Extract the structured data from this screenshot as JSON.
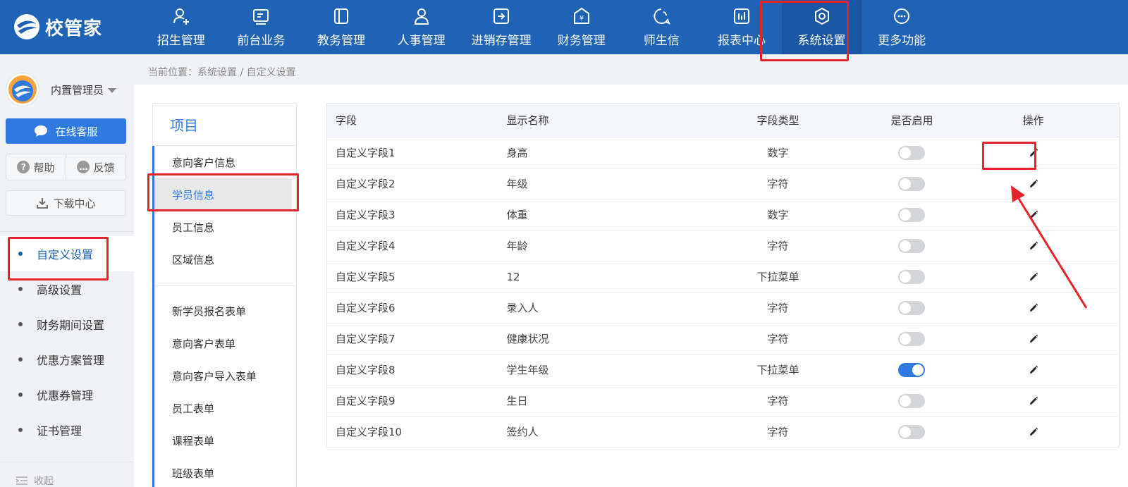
{
  "brand": {
    "name": "校管家"
  },
  "nav": [
    {
      "label": "招生管理",
      "icon": "user-plus-icon"
    },
    {
      "label": "前台业务",
      "icon": "monitor-icon"
    },
    {
      "label": "教务管理",
      "icon": "book-icon"
    },
    {
      "label": "人事管理",
      "icon": "person-icon"
    },
    {
      "label": "进销存管理",
      "icon": "arrow-box-icon"
    },
    {
      "label": "财务管理",
      "icon": "yen-icon"
    },
    {
      "label": "师生信",
      "icon": "chat-icon"
    },
    {
      "label": "报表中心",
      "icon": "bar-chart-icon"
    },
    {
      "label": "系统设置",
      "icon": "gear-icon",
      "active": true
    },
    {
      "label": "更多功能",
      "icon": "more-icon"
    }
  ],
  "user": {
    "name": "内置管理员"
  },
  "sidebar": {
    "service_label": "在线客服",
    "help_label": "帮助",
    "feedback_label": "反馈",
    "download_label": "下载中心",
    "menu": [
      {
        "label": "自定义设置",
        "active": true
      },
      {
        "label": "高级设置"
      },
      {
        "label": "财务期间设置"
      },
      {
        "label": "优惠方案管理"
      },
      {
        "label": "优惠券管理"
      },
      {
        "label": "证书管理"
      }
    ],
    "collapse_label": "收起"
  },
  "breadcrumb": "当前位置：系统设置 / 自定义设置",
  "categories": {
    "title": "项目",
    "group1": [
      "意向客户信息",
      "学员信息",
      "员工信息",
      "区域信息"
    ],
    "group2": [
      "新学员报名表单",
      "意向客户表单",
      "意向客户导入表单",
      "员工表单",
      "课程表单",
      "班级表单"
    ],
    "active": "学员信息"
  },
  "table": {
    "headers": {
      "field": "字段",
      "display": "显示名称",
      "type": "字段类型",
      "enabled": "是否启用",
      "action": "操作"
    },
    "rows": [
      {
        "field": "自定义字段1",
        "display": "身高",
        "type": "数字",
        "enabled": false
      },
      {
        "field": "自定义字段2",
        "display": "年级",
        "type": "字符",
        "enabled": false
      },
      {
        "field": "自定义字段3",
        "display": "体重",
        "type": "数字",
        "enabled": false
      },
      {
        "field": "自定义字段4",
        "display": "年龄",
        "type": "字符",
        "enabled": false
      },
      {
        "field": "自定义字段5",
        "display": "12",
        "type": "下拉菜单",
        "enabled": false
      },
      {
        "field": "自定义字段6",
        "display": "录入人",
        "type": "字符",
        "enabled": false
      },
      {
        "field": "自定义字段7",
        "display": "健康状况",
        "type": "字符",
        "enabled": false
      },
      {
        "field": "自定义字段8",
        "display": "学生年级",
        "type": "下拉菜单",
        "enabled": true
      },
      {
        "field": "自定义字段9",
        "display": "生日",
        "type": "字符",
        "enabled": false
      },
      {
        "field": "自定义字段10",
        "display": "签约人",
        "type": "字符",
        "enabled": false
      }
    ]
  },
  "colors": {
    "header_bg": "#2062b4",
    "accent": "#2f7ae0",
    "highlight": "#e6222a"
  }
}
